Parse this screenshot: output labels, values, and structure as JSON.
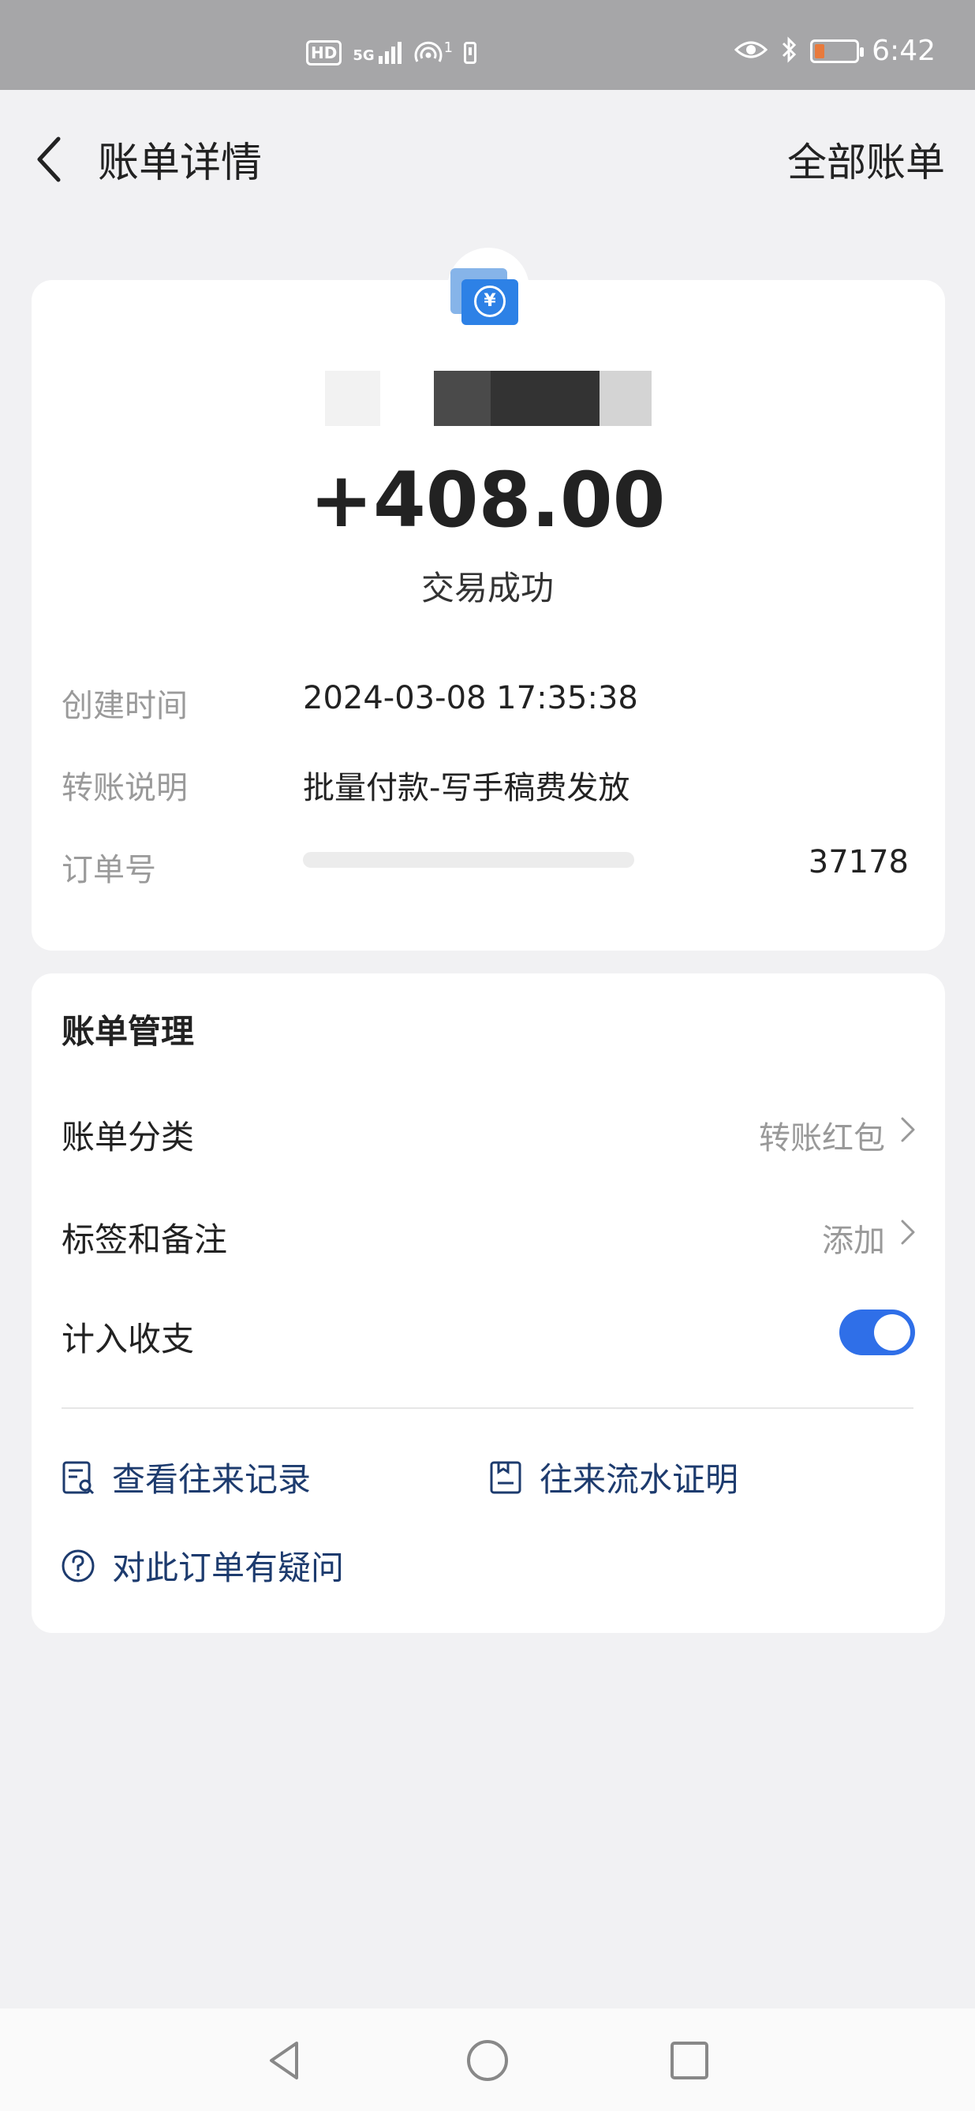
{
  "status_bar": {
    "hd": "HD",
    "network": "5G",
    "hotspot_count": "1",
    "time": "6:42"
  },
  "header": {
    "title": "账单详情",
    "right_action": "全部账单"
  },
  "transaction": {
    "amount": "+408.00",
    "status": "交易成功",
    "details": [
      {
        "label": "创建时间",
        "value": "2024-03-08 17:35:38"
      },
      {
        "label": "转账说明",
        "value": "批量付款-写手稿费发放"
      },
      {
        "label": "订单号",
        "value": "37178"
      }
    ]
  },
  "manage": {
    "title": "账单管理",
    "category_label": "账单分类",
    "category_value": "转账红包",
    "tags_label": "标签和备注",
    "tags_value": "添加",
    "include_label": "计入收支",
    "include_on": true,
    "actions": {
      "records": "查看往来记录",
      "proof": "往来流水证明",
      "question": "对此订单有疑问"
    }
  },
  "colors": {
    "accent": "#2f6fe8",
    "action_text": "#1d3b6e",
    "status_bar": "#a6a6a8"
  }
}
